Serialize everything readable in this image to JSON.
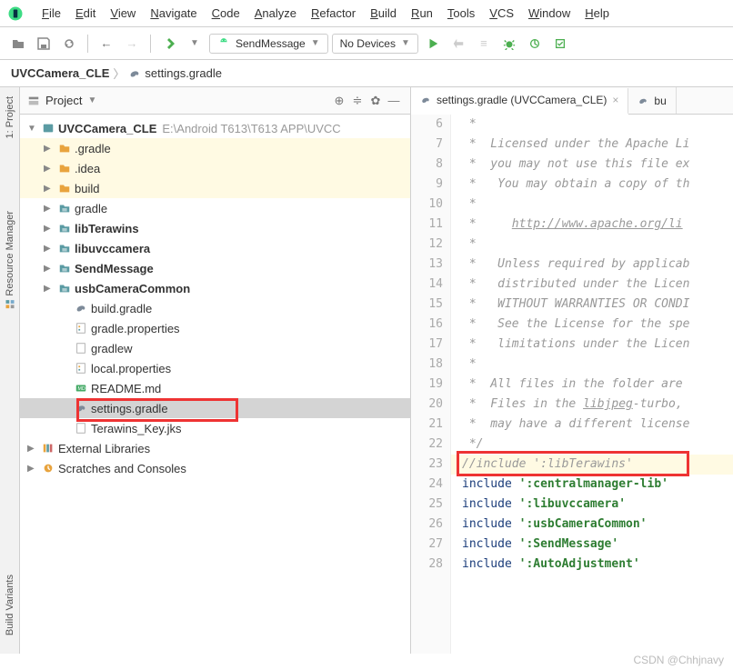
{
  "menubar": [
    "File",
    "Edit",
    "View",
    "Navigate",
    "Code",
    "Analyze",
    "Refactor",
    "Build",
    "Run",
    "Tools",
    "VCS",
    "Window",
    "Help"
  ],
  "toolbar": {
    "run_config": "SendMessage",
    "device": "No Devices"
  },
  "breadcrumb": {
    "root": "UVCCamera_CLE",
    "file": "settings.gradle"
  },
  "panel": {
    "title": "Project",
    "gutter_project": "1: Project",
    "gutter_resmgr": "Resource Manager",
    "gutter_build": "Build Variants"
  },
  "tree": {
    "root_name": "UVCCamera_CLE",
    "root_path": "E:\\Android T613\\T613 APP\\UVCC",
    "items": [
      {
        "label": ".gradle",
        "icon": "folder-orange",
        "hl": true,
        "indent": 1,
        "chev": "r"
      },
      {
        "label": ".idea",
        "icon": "folder-orange",
        "hl": true,
        "indent": 1,
        "chev": "r"
      },
      {
        "label": "build",
        "icon": "folder-orange",
        "hl": true,
        "indent": 1,
        "chev": "r"
      },
      {
        "label": "gradle",
        "icon": "folder-teal",
        "indent": 1,
        "chev": "r"
      },
      {
        "label": "libTerawins",
        "icon": "folder-teal",
        "bold": true,
        "indent": 1,
        "chev": "r"
      },
      {
        "label": "libuvccamera",
        "icon": "folder-teal",
        "bold": true,
        "indent": 1,
        "chev": "r"
      },
      {
        "label": "SendMessage",
        "icon": "folder-teal",
        "bold": true,
        "indent": 1,
        "chev": "r"
      },
      {
        "label": "usbCameraCommon",
        "icon": "folder-teal",
        "bold": true,
        "indent": 1,
        "chev": "r"
      },
      {
        "label": "build.gradle",
        "icon": "elephant",
        "indent": 2
      },
      {
        "label": "gradle.properties",
        "icon": "props",
        "indent": 2
      },
      {
        "label": "gradlew",
        "icon": "file",
        "indent": 2
      },
      {
        "label": "local.properties",
        "icon": "props",
        "indent": 2
      },
      {
        "label": "README.md",
        "icon": "md",
        "indent": 2
      },
      {
        "label": "settings.gradle",
        "icon": "elephant",
        "indent": 2,
        "selected": true
      },
      {
        "label": "Terawins_Key.jks",
        "icon": "file",
        "indent": 2
      }
    ],
    "ext_lib": "External Libraries",
    "scratches": "Scratches and Consoles"
  },
  "editor": {
    "tab_active": "settings.gradle (UVCCamera_CLE)",
    "tab_other": "bu",
    "first_line": 6,
    "lines": [
      " *",
      " *  Licensed under the Apache Li",
      " *  you may not use this file ex",
      " *   You may obtain a copy of th",
      " *",
      " *     http://www.apache.org/li",
      " *",
      " *   Unless required by applicab",
      " *   distributed under the Licen",
      " *   WITHOUT WARRANTIES OR CONDI",
      " *   See the License for the spe",
      " *   limitations under the Licen",
      " *",
      " *  All files in the folder are ",
      " *  Files in the libjpeg-turbo, ",
      " *  may have a different license",
      " */",
      "//include ':libTerawins'",
      "include ':centralmanager-lib'",
      "include ':libuvccamera'",
      "include ':usbCameraCommon'",
      "include ':SendMessage'",
      "include ':AutoAdjustment'"
    ]
  },
  "watermark": "CSDN @Chhjnavy"
}
